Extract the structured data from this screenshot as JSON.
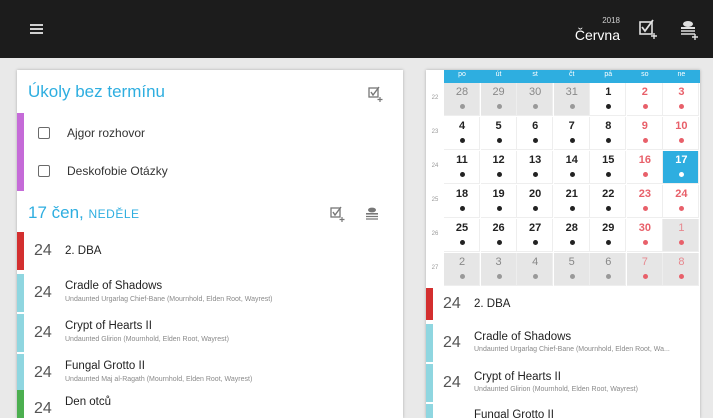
{
  "topbar": {
    "month_year": "2018",
    "month_name": "Června"
  },
  "no_deadline": {
    "title": "Úkoly bez termínu",
    "tasks": [
      {
        "label": "Ajgor rozhovor",
        "color": "#c56bd8"
      },
      {
        "label": "Deskofobie Otázky",
        "color": "#c56bd8"
      }
    ]
  },
  "day_section": {
    "title": "17 čen,",
    "weekday": "NEDĚLE"
  },
  "events": [
    {
      "day": "24",
      "title": "2. DBA",
      "subtitle": "",
      "color": "#d32f2f",
      "locked": false
    },
    {
      "day": "24",
      "title": "Cradle of Shadows",
      "subtitle": "Undaunted Urgarlag Chief-Bane (Mournhold, Elden Root, Wayrest)",
      "color": "#8fd6e0",
      "locked": false
    },
    {
      "day": "24",
      "title": "Crypt of Hearts II",
      "subtitle": "Undaunted Glirion (Mournhold, Elden Root, Wayrest)",
      "color": "#8fd6e0",
      "locked": false
    },
    {
      "day": "24",
      "title": "Fungal Grotto II",
      "subtitle": "Undaunted Maj al-Ragath (Mournhold, Elden Root, Wayrest)",
      "color": "#8fd6e0",
      "locked": false
    },
    {
      "day": "24",
      "title": "Den otců",
      "subtitle": "",
      "color": "#4caf50",
      "locked": true
    }
  ],
  "calendar": {
    "weekdays": [
      "po",
      "út",
      "st",
      "čt",
      "pá",
      "so",
      "ne"
    ],
    "weeks": [
      {
        "week": "22",
        "days": [
          {
            "d": "28",
            "other": true
          },
          {
            "d": "29",
            "other": true
          },
          {
            "d": "30",
            "other": true
          },
          {
            "d": "31",
            "other": true
          },
          {
            "d": "1",
            "other": false
          },
          {
            "d": "2",
            "other": false
          },
          {
            "d": "3",
            "other": false
          }
        ]
      },
      {
        "week": "23",
        "days": [
          {
            "d": "4",
            "other": false
          },
          {
            "d": "5",
            "other": false
          },
          {
            "d": "6",
            "other": false
          },
          {
            "d": "7",
            "other": false
          },
          {
            "d": "8",
            "other": false
          },
          {
            "d": "9",
            "other": false
          },
          {
            "d": "10",
            "other": false
          }
        ]
      },
      {
        "week": "24",
        "days": [
          {
            "d": "11",
            "other": false
          },
          {
            "d": "12",
            "other": false
          },
          {
            "d": "13",
            "other": false
          },
          {
            "d": "14",
            "other": false
          },
          {
            "d": "15",
            "other": false
          },
          {
            "d": "16",
            "other": false
          },
          {
            "d": "17",
            "other": false,
            "selected": true
          }
        ]
      },
      {
        "week": "25",
        "days": [
          {
            "d": "18",
            "other": false
          },
          {
            "d": "19",
            "other": false
          },
          {
            "d": "20",
            "other": false
          },
          {
            "d": "21",
            "other": false
          },
          {
            "d": "22",
            "other": false
          },
          {
            "d": "23",
            "other": false
          },
          {
            "d": "24",
            "other": false
          }
        ]
      },
      {
        "week": "26",
        "days": [
          {
            "d": "25",
            "other": false
          },
          {
            "d": "26",
            "other": false
          },
          {
            "d": "27",
            "other": false
          },
          {
            "d": "28",
            "other": false
          },
          {
            "d": "29",
            "other": false
          },
          {
            "d": "30",
            "other": false
          },
          {
            "d": "1",
            "other": true
          }
        ]
      },
      {
        "week": "27",
        "days": [
          {
            "d": "2",
            "other": true
          },
          {
            "d": "3",
            "other": true
          },
          {
            "d": "4",
            "other": true
          },
          {
            "d": "5",
            "other": true
          },
          {
            "d": "6",
            "other": true
          },
          {
            "d": "7",
            "other": true
          },
          {
            "d": "8",
            "other": true
          }
        ]
      }
    ]
  },
  "right_events": [
    {
      "day": "24",
      "title": "2. DBA",
      "subtitle": "",
      "color": "#d32f2f"
    },
    {
      "day": "24",
      "title": "Cradle of Shadows",
      "subtitle": "Undaunted Urgarlag Chief-Bane (Mournhold, Elden Root, Wa...",
      "color": "#8fd6e0"
    },
    {
      "day": "24",
      "title": "Crypt of Hearts II",
      "subtitle": "Undaunted Glirion (Mournhold, Elden Root, Wayrest)",
      "color": "#8fd6e0"
    },
    {
      "day": "24",
      "title": "Fungal Grotto II",
      "subtitle": "",
      "color": "#8fd6e0"
    }
  ],
  "colors": {
    "accent": "#2eaee0",
    "weekend": "#e8606a"
  }
}
